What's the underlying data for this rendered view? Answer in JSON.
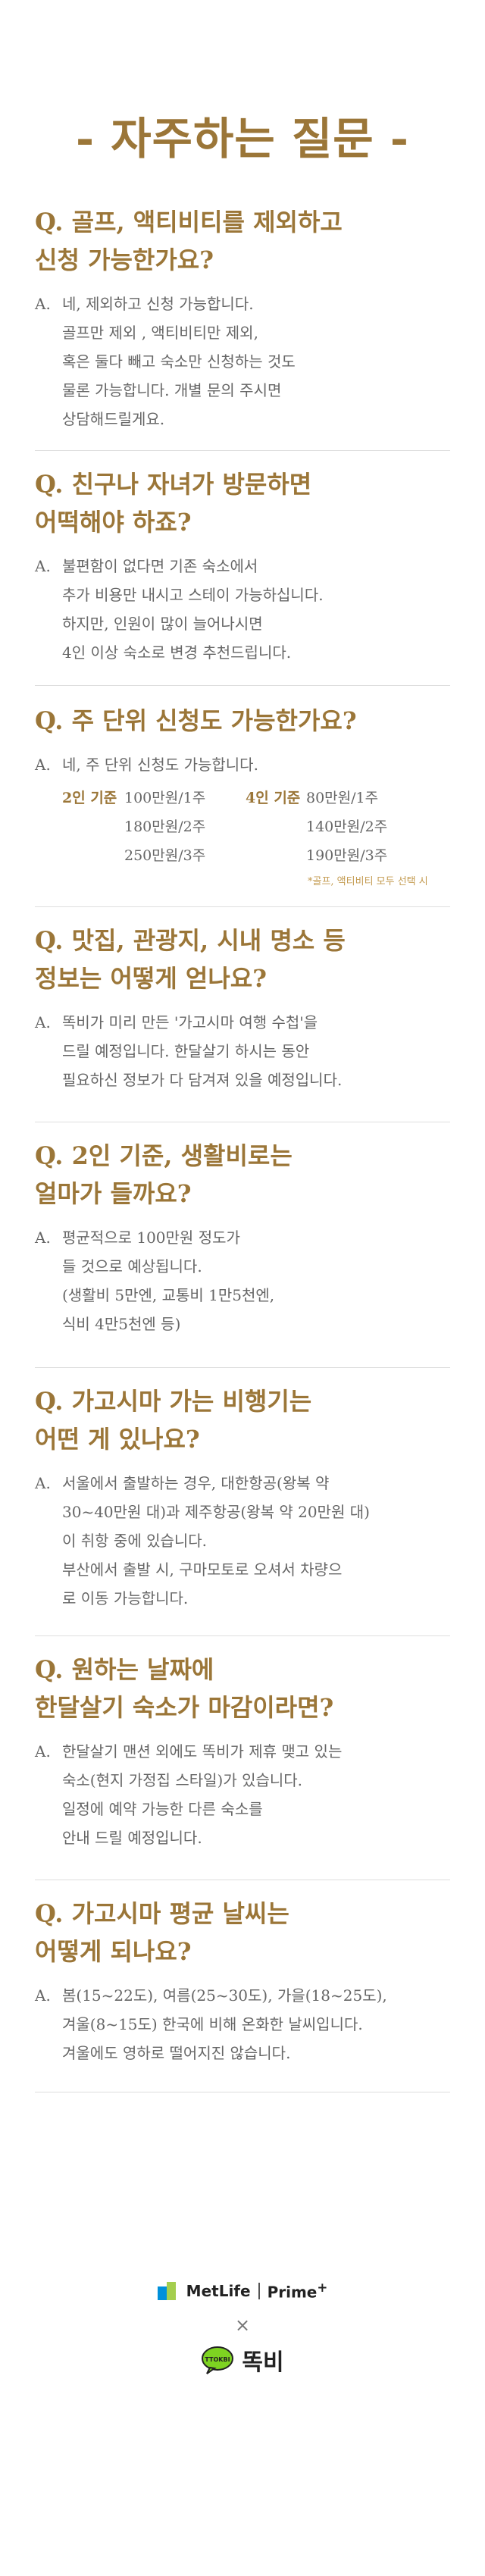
{
  "title": "- 자주하는 질문 -",
  "faqs": [
    {
      "question": "Q. 골프, 액티비티를 제외하고\n신청 가능한가요?",
      "answer_mark": "A.",
      "answer": "네, 제외하고 신청 가능합니다.\n골프만 제외 , 액티비티만 제외,\n혹은 둘다 빼고 숙소만 신청하는 것도\n물론 가능합니다. 개별 문의 주시면\n상담해드릴게요."
    },
    {
      "question": "Q. 친구나 자녀가 방문하면\n어떡해야 하죠?",
      "answer_mark": "A.",
      "answer": "불편함이 없다면 기존 숙소에서\n추가 비용만 내시고 스테이 가능하십니다.\n하지만, 인원이 많이 늘어나시면\n4인 이상 숙소로 변경 추천드립니다."
    },
    {
      "question": "Q. 주 단위 신청도 가능한가요?",
      "answer_mark": "A.",
      "answer": "네, 주 단위 신청도 가능합니다.",
      "pricing": {
        "groups": [
          {
            "label": "2인 기준",
            "prices": [
              "100만원/1주",
              "180만원/2주",
              "250만원/3주"
            ]
          },
          {
            "label": "4인 기준",
            "prices": [
              "80만원/1주",
              "140만원/2주",
              "190만원/3주"
            ]
          }
        ],
        "note": "*골프, 액티비티 모두 선택 시"
      }
    },
    {
      "question": "Q. 맛집, 관광지, 시내 명소 등\n정보는 어떻게 얻나요?",
      "answer_mark": "A.",
      "answer": "똑비가 미리 만든 '가고시마 여행 수첩'을\n드릴 예정입니다. 한달살기 하시는 동안\n필요하신 정보가 다 담겨져 있을 예정입니다."
    },
    {
      "question": "Q. 2인 기준, 생활비로는\n얼마가 들까요?",
      "answer_mark": "A.",
      "answer": "평균적으로 100만원 정도가\n들 것으로 예상됩니다.\n(생활비 5만엔, 교통비 1만5천엔,\n식비 4만5천엔 등)"
    },
    {
      "question": "Q. 가고시마 가는 비행기는\n어떤 게 있나요?",
      "answer_mark": "A.",
      "answer": "서울에서 출발하는 경우, 대한항공(왕복 약\n30~40만원 대)과 제주항공(왕복 약 20만원 대)\n이 취항 중에 있습니다.\n부산에서 출발 시, 구마모토로 오셔서 차량으\n로 이동 가능합니다."
    },
    {
      "question": "Q. 원하는 날짜에\n한달살기 숙소가 마감이라면?",
      "answer_mark": "A.",
      "answer": "한달살기 맨션 외에도 똑비가 제휴 맺고 있는\n숙소(현지 가정집 스타일)가 있습니다.\n일정에 예약 가능한 다른 숙소를\n안내 드릴 예정입니다."
    },
    {
      "question": "Q. 가고시마 평균 날씨는\n어떻게 되나요?",
      "answer_mark": "A.",
      "answer": "봄(15~22도), 여름(25~30도), 가을(18~25도),\n겨울(8~15도) 한국에 비해 온화한 날씨입니다.\n겨울에도 영하로 떨어지진 않습니다."
    }
  ],
  "footer": {
    "metlife": "MetLife",
    "prime": "Prime",
    "prime_plus": "+",
    "times": "×",
    "ttokbi": "똑비",
    "ttokbi_badge": "TTOKBI"
  },
  "colors": {
    "accent": "#9b7638",
    "metlife_blue": "#0090da",
    "metlife_green": "#a4ce4e",
    "ttokbi_green": "#7ed321"
  }
}
